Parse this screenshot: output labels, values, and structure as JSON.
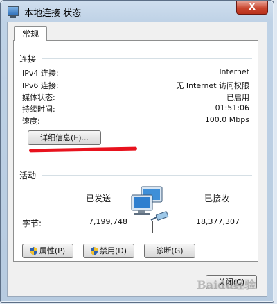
{
  "window": {
    "title": "本地连接 状态",
    "close_label": "X"
  },
  "tabs": [
    {
      "label": "常规"
    }
  ],
  "connection": {
    "heading": "连接",
    "rows": [
      {
        "label": "IPv4 连接:",
        "value": "Internet"
      },
      {
        "label": "IPv6 连接:",
        "value": "无 Internet 访问权限"
      },
      {
        "label": "媒体状态:",
        "value": "已启用"
      },
      {
        "label": "持续时间:",
        "value": "01:51:06"
      },
      {
        "label": "速度:",
        "value": "100.0 Mbps"
      }
    ],
    "details_button": "详细信息(E)..."
  },
  "activity": {
    "heading": "活动",
    "sent_label": "已发送",
    "received_label": "已接收",
    "bytes_label": "字节:",
    "bytes_sent": "7,199,748",
    "bytes_received": "18,377,307"
  },
  "buttons": {
    "properties": "属性(P)",
    "disable": "禁用(D)",
    "diagnose": "诊断(G)",
    "close": "关闭(C)"
  },
  "annotation": {
    "color": "#e8121d"
  },
  "icons": [
    "network-computers-icon",
    "uac-shield-icon",
    "close-icon"
  ],
  "watermark": "Baidu经验"
}
